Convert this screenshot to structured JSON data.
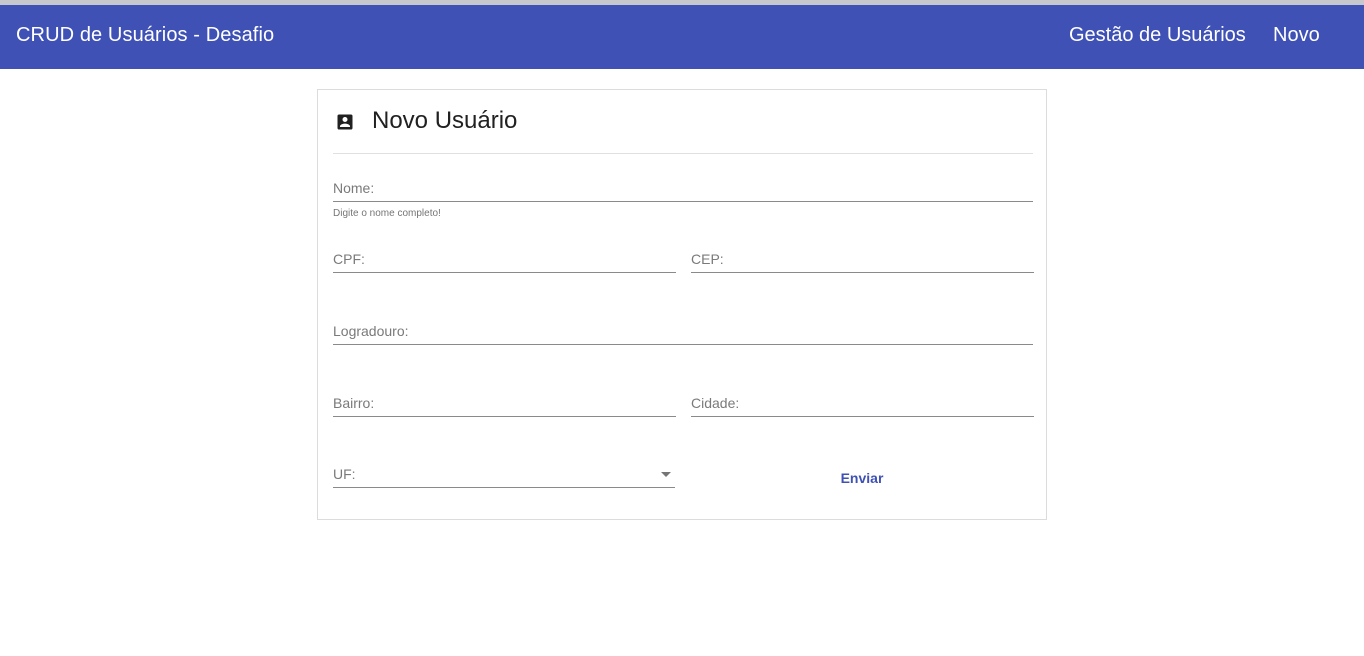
{
  "toolbar": {
    "title": "CRUD de Usuários - Desafio",
    "nav": {
      "gestao": "Gestão de Usuários",
      "novo": "Novo"
    },
    "color": "#3f51b5"
  },
  "form": {
    "title": "Novo Usuário",
    "icon": "account-box-icon",
    "fields": {
      "nome": {
        "label": "Nome:",
        "value": "",
        "hint": "Digite o nome completo!"
      },
      "cpf": {
        "label": "CPF:",
        "value": ""
      },
      "cep": {
        "label": "CEP:",
        "value": ""
      },
      "logradouro": {
        "label": "Logradouro:",
        "value": ""
      },
      "bairro": {
        "label": "Bairro:",
        "value": ""
      },
      "cidade": {
        "label": "Cidade:",
        "value": ""
      },
      "uf": {
        "label": "UF:",
        "value": ""
      }
    },
    "submit_label": "Enviar"
  }
}
